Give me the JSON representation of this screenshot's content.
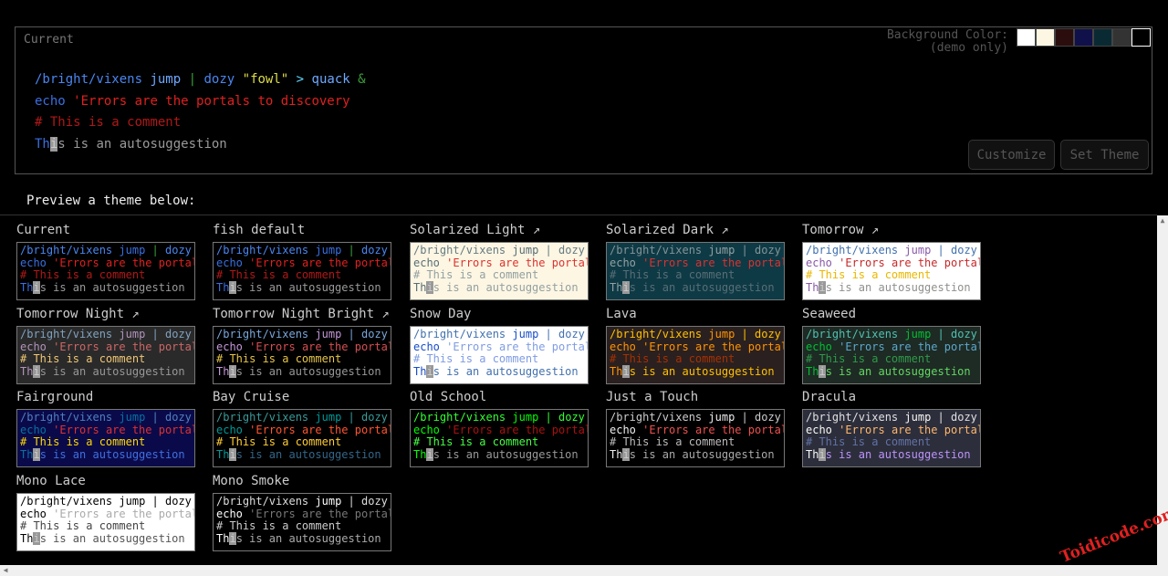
{
  "current": {
    "label": "Current",
    "bg_label_line1": "Background Color:",
    "bg_label_line2": "(demo only)",
    "swatches": [
      "#ffffff",
      "#fdf6e3",
      "#2b0d0d",
      "#10104a",
      "#0a2a33",
      "#333333",
      "#000000"
    ],
    "lines": [
      [
        {
          "t": "/bright/vixens",
          "c": "#4a86f0"
        },
        {
          "t": " "
        },
        {
          "t": "jump",
          "c": "#6fa8ff"
        },
        {
          "t": " "
        },
        {
          "t": "|",
          "c": "#3aa03a"
        },
        {
          "t": " "
        },
        {
          "t": "dozy",
          "c": "#4a86f0"
        },
        {
          "t": " "
        },
        {
          "t": "\"fowl\"",
          "c": "#dede4a"
        },
        {
          "t": " "
        },
        {
          "t": ">",
          "c": "#5fd7ff"
        },
        {
          "t": " "
        },
        {
          "t": "quack",
          "c": "#6fa8ff"
        },
        {
          "t": " "
        },
        {
          "t": "&",
          "c": "#3aa03a"
        }
      ],
      [
        {
          "t": "echo",
          "c": "#3a6fe0"
        },
        {
          "t": " "
        },
        {
          "t": "'Errors are the portals to discovery",
          "c": "#e02020"
        }
      ],
      [
        {
          "t": "# This is a comment",
          "c": "#b01818"
        }
      ],
      [
        {
          "t": "Th",
          "c": "#3a6fe0"
        },
        {
          "t": "i",
          "cur": true
        },
        {
          "t": "s is an autosuggestion",
          "c": "#9a9a9a"
        }
      ]
    ]
  },
  "buttons": {
    "customize": "Customize",
    "set_theme": "Set Theme"
  },
  "preview_heading": "Preview a theme below:",
  "watermark": "Toidicode.com",
  "themes": [
    {
      "name": "Current",
      "bg": "#000000",
      "cmd": "#3a6fe0",
      "param": "#4a86f0",
      "op": "#3aa03a",
      "quote": "#dede4a",
      "err": "#e02020",
      "cm": "#b01818",
      "sug": "#9a9a9a"
    },
    {
      "name": "fish default",
      "bg": "#000000",
      "cmd": "#3a6fe0",
      "param": "#4a86f0",
      "op": "#3aa03a",
      "quote": "#dede4a",
      "err": "#e02020",
      "cm": "#b01818",
      "sug": "#9a9a9a"
    },
    {
      "name": "Solarized Light ↗",
      "bg": "#fdf6e3",
      "cmd": "#586e75",
      "param": "#657b83",
      "op": "#657b83",
      "quote": "#657b83",
      "err": "#dc322f",
      "cm": "#93a1a1",
      "sug": "#93a1a1"
    },
    {
      "name": "Solarized Dark ↗",
      "bg": "#0e3a46",
      "cmd": "#93a1a1",
      "param": "#839496",
      "op": "#839496",
      "quote": "#839496",
      "err": "#dc322f",
      "cm": "#586e75",
      "sug": "#586e75"
    },
    {
      "name": "Tomorrow ↗",
      "bg": "#ffffff",
      "cmd": "#8959a8",
      "param": "#4271ae",
      "op": "#4271ae",
      "quote": "#4271ae",
      "err": "#c82829",
      "cm": "#eab700",
      "sug": "#8e908c"
    },
    {
      "name": "Tomorrow Night ↗",
      "bg": "#2a2a2a",
      "cmd": "#b294bb",
      "param": "#81a2be",
      "op": "#81a2be",
      "quote": "#81a2be",
      "err": "#cc6666",
      "cm": "#f0c674",
      "sug": "#969896"
    },
    {
      "name": "Tomorrow Night Bright ↗",
      "bg": "#000000",
      "cmd": "#c397d8",
      "param": "#7aa6da",
      "op": "#7aa6da",
      "quote": "#7aa6da",
      "err": "#d54e53",
      "cm": "#e7c547",
      "sug": "#969896"
    },
    {
      "name": "Snow Day",
      "bg": "#ffffff",
      "cmd": "#164cc9",
      "param": "#4271ae",
      "op": "#4271ae",
      "quote": "#4271ae",
      "err": "#7f9ce3",
      "cm": "#7f9ce3",
      "sug": "#4271ae"
    },
    {
      "name": "Lava",
      "bg": "#2a2020",
      "cmd": "#ff9400",
      "param": "#ffc000",
      "op": "#ffc000",
      "quote": "#ffc000",
      "err": "#ff9400",
      "cm": "#a63100",
      "sug": "#ffc000"
    },
    {
      "name": "Seaweed",
      "bg": "#1e2a24",
      "cmd": "#00bf32",
      "param": "#50c0b0",
      "op": "#50c0b0",
      "quote": "#50c0b0",
      "err": "#5ba8cc",
      "cm": "#2f9a4a",
      "sug": "#62d862"
    },
    {
      "name": "Fairground",
      "bg": "#0a0a4a",
      "cmd": "#0772a1",
      "param": "#5080c0",
      "op": "#5080c0",
      "quote": "#5080c0",
      "err": "#e03030",
      "cm": "#ffd900",
      "sug": "#4070e0"
    },
    {
      "name": "Bay Cruise",
      "bg": "#000000",
      "cmd": "#009999",
      "param": "#3a9a9a",
      "op": "#3a9a9a",
      "quote": "#3a9a9a",
      "err": "#ff5530",
      "cm": "#ffcc33",
      "sug": "#336688"
    },
    {
      "name": "Old School",
      "bg": "#000000",
      "cmd": "#00ff00",
      "param": "#33ff33",
      "op": "#33ff33",
      "quote": "#33ff33",
      "err": "#aa1111",
      "cm": "#44ff44",
      "sug": "#999999"
    },
    {
      "name": "Just a Touch",
      "bg": "#000000",
      "cmd": "#eeeeee",
      "param": "#cccccc",
      "op": "#cccccc",
      "quote": "#cccccc",
      "err": "#ee5050",
      "cm": "#bbbbbb",
      "sug": "#aaaaaa"
    },
    {
      "name": "Dracula",
      "bg": "#2c2e3c",
      "cmd": "#f8f8f2",
      "param": "#e0e0e0",
      "op": "#e0e0e0",
      "quote": "#e0e0e0",
      "err": "#ffb86c",
      "cm": "#6272a4",
      "sug": "#bd93f9"
    },
    {
      "name": "Mono Lace",
      "bg": "#ffffff",
      "cmd": "#000000",
      "param": "#000000",
      "op": "#000000",
      "quote": "#000000",
      "err": "#aaaaaa",
      "cm": "#444444",
      "sug": "#555555"
    },
    {
      "name": "Mono Smoke",
      "bg": "#000000",
      "cmd": "#ffffff",
      "param": "#dddddd",
      "op": "#dddddd",
      "quote": "#dddddd",
      "err": "#777777",
      "cm": "#cccccc",
      "sug": "#aaaaaa"
    }
  ],
  "sample": {
    "line1_a": "/bright/vixens",
    "line1_b": "jump",
    "line1_c": "|",
    "line1_d": "dozy",
    "line1_e": "\"",
    "echo": "echo",
    "err": "'Errors are the portals",
    "comment": "# This is a comment",
    "sug_a": "Th",
    "sug_cursor": "i",
    "sug_b": "s is an autosuggestion"
  }
}
